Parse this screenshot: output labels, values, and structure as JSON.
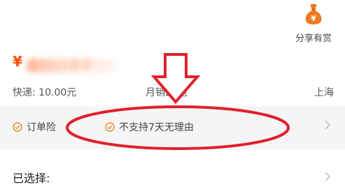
{
  "share": {
    "label": "分享有赏",
    "icon": "money-bag-icon"
  },
  "price": {
    "currency": "¥",
    "value": "1·· ·88"
  },
  "shipping": {
    "text": "快递: 10.00元"
  },
  "sales": {
    "text": "月销25笔"
  },
  "location": {
    "text": "上海"
  },
  "services": [
    {
      "label": "订单险",
      "icon": "check-circle-icon"
    },
    {
      "label": "不支持7天无理由",
      "icon": "check-circle-icon"
    }
  ],
  "selection": {
    "label": "已选择:"
  },
  "colors": {
    "accent": "#ff5000",
    "annotation": "#e0202e",
    "band": "#f5f5f5"
  }
}
